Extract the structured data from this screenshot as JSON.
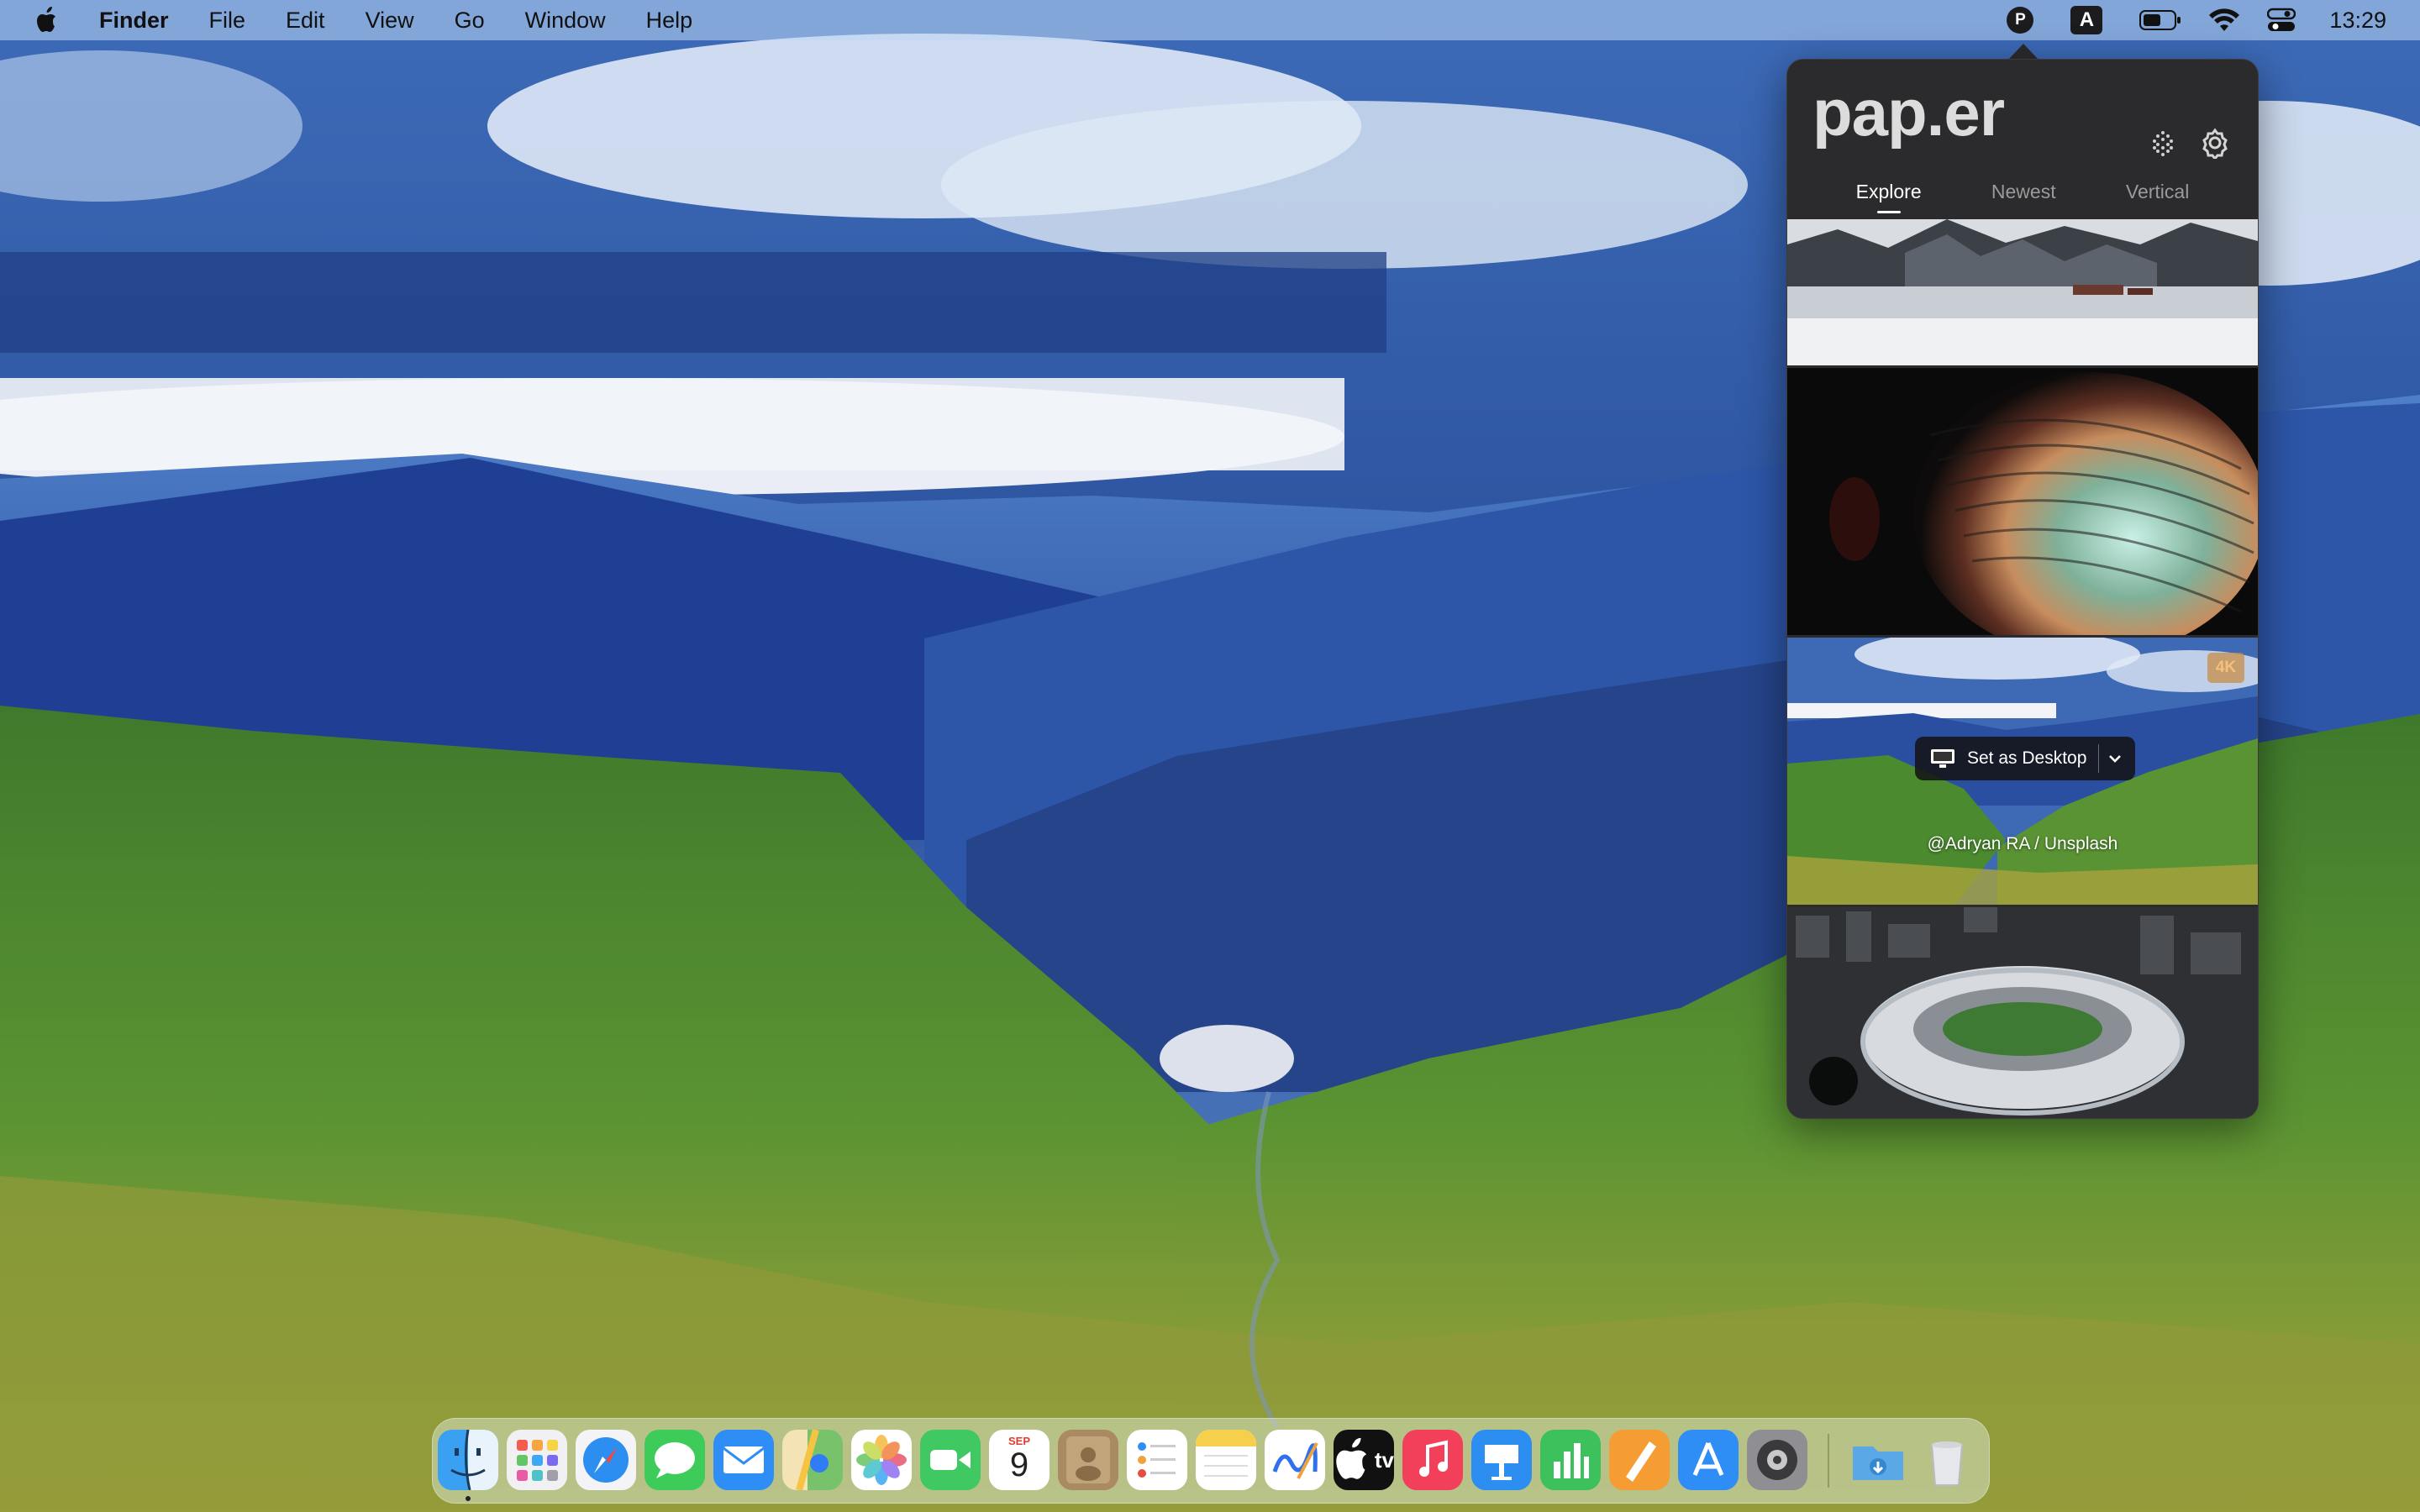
{
  "menubar": {
    "app_name": "Finder",
    "items": [
      "File",
      "Edit",
      "View",
      "Go",
      "Window",
      "Help"
    ],
    "status_icons": [
      "paper-app-icon",
      "keyboard-input-icon",
      "battery-icon",
      "wifi-icon",
      "control-center-icon"
    ],
    "paper_icon_letter": "P",
    "input_letter": "A",
    "clock": "13:29"
  },
  "paper": {
    "logo": "pap.er",
    "header_icons": [
      "grid-dots-icon",
      "gear-icon"
    ],
    "tabs": [
      {
        "label": "Explore",
        "active": true
      },
      {
        "label": "Newest",
        "active": false
      },
      {
        "label": "Vertical",
        "active": false
      }
    ],
    "thumbnails": [
      {
        "subject": "snowy-lake-mountains"
      },
      {
        "subject": "abstract-colorful-tunnel"
      },
      {
        "subject": "green-mountain-valley",
        "badge": "4K",
        "hovered": true
      },
      {
        "subject": "stadium-aerial"
      }
    ],
    "hover_actions": {
      "set_desktop_label": "Set as Desktop",
      "credit": "@Adryan RA / Unsplash"
    }
  },
  "dock": {
    "apps": [
      "Finder",
      "Launchpad",
      "Safari",
      "Messages",
      "Mail",
      "Maps",
      "Photos",
      "FaceTime",
      "Calendar",
      "Contacts",
      "Reminders",
      "Notes",
      "Freeform",
      "TV",
      "Music",
      "Keynote",
      "Numbers",
      "Pages",
      "App Store",
      "System Settings"
    ],
    "calendar": {
      "month": "SEP",
      "day": "9"
    },
    "tv_label": "tv",
    "extras": [
      "Downloads",
      "Trash"
    ],
    "running": [
      "Finder"
    ]
  },
  "colors": {
    "popover_bg": "#2b2b2d",
    "sky": "#3b64b0",
    "grass": "#4f8a2e"
  }
}
